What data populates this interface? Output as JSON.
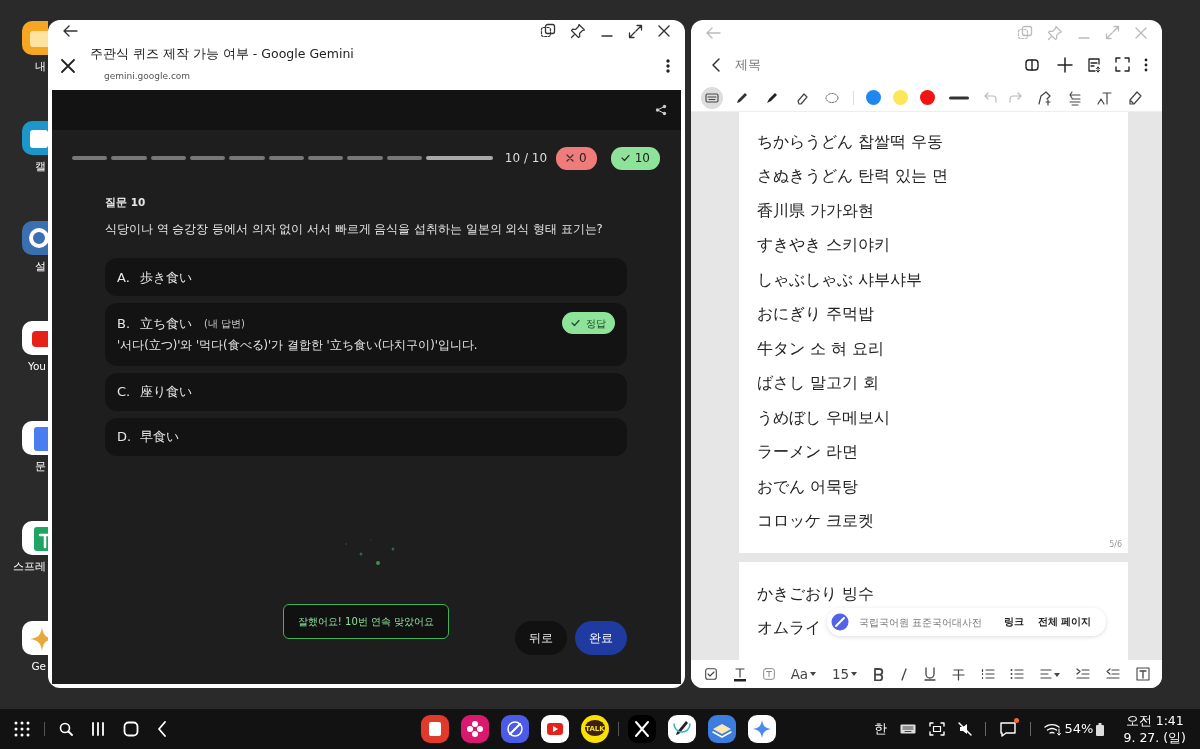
{
  "desktop_icons": [
    {
      "kind": "folder",
      "label": "내"
    },
    {
      "kind": "calendar",
      "label": "캘"
    },
    {
      "kind": "settings",
      "label": "설"
    },
    {
      "kind": "youtube",
      "label": "You"
    },
    {
      "kind": "docs",
      "label": "문"
    },
    {
      "kind": "sheets",
      "label": "스프레"
    },
    {
      "kind": "gemini",
      "label": "Ge"
    }
  ],
  "quiz_window": {
    "title": "주관식 퀴즈 제작 가능 여부 - Google Gemini",
    "url": "gemini.google.com",
    "progress": [
      {
        "current": false
      },
      {
        "current": false
      },
      {
        "current": false
      },
      {
        "current": false
      },
      {
        "current": false
      },
      {
        "current": false
      },
      {
        "current": false
      },
      {
        "current": false
      },
      {
        "current": false
      },
      {
        "current": true
      }
    ],
    "counter": "10 / 10",
    "wrong_count": "0",
    "right_count": "10",
    "question_label": "질문 10",
    "question": "식당이나 역 승강장 등에서 의자 없이 서서 빠르게 음식을 섭취하는 일본의 외식 형태 표기는?",
    "options": [
      {
        "letter": "A.",
        "text": "歩き食い"
      },
      {
        "letter": "B.",
        "text": "立ち食い",
        "note": "(내 답변)",
        "badge": "정답",
        "explanation": "'서다(立つ)'와 '먹다(食べる)'가 결합한 '立ち食い(다치구이)'입니다."
      },
      {
        "letter": "C.",
        "text": "座り食い"
      },
      {
        "letter": "D.",
        "text": "早食い"
      }
    ],
    "toast": "잘했어요! 10번 연속 맞았어요",
    "back_button": "뒤로",
    "done_button": "완료"
  },
  "notes_window": {
    "title": "제목",
    "tools": [
      {
        "kind": "keyboard",
        "selected": true
      },
      {
        "kind": "pen",
        "selected": false
      },
      {
        "kind": "highlighter",
        "selected": false
      },
      {
        "kind": "eraser",
        "selected": false
      },
      {
        "kind": "lasso",
        "selected": false
      }
    ],
    "colors": [
      {
        "color": "#1e88f0"
      },
      {
        "color": "#fde65a"
      },
      {
        "color": "#f01414"
      }
    ],
    "pages": [
      {
        "lines": [
          "ちからうどん 찹쌀떡 우동",
          "さぬきうどん 탄력 있는 면",
          "香川県 가가와현",
          "すきやき 스키야키",
          "しゃぶしゃぶ 샤부샤부",
          "おにぎり 주먹밥",
          "牛タン 소 혀 요리",
          "ばさし 말고기 회",
          "うめぼし 우메보시",
          "ラーメン 라면",
          "おでん 어묵탕",
          "コロッケ 크로켓"
        ],
        "page_number": "5/6"
      },
      {
        "lines": [
          "かきごおり 빙수",
          "オムライ"
        ]
      }
    ],
    "popup": {
      "source": "국립국어원 표준국어대사전",
      "actions": [
        "링크",
        "전체 페이지"
      ]
    },
    "font_button": "Aa",
    "size_button": "15"
  },
  "taskbar": {
    "dock": [
      {
        "kind": "notes"
      },
      {
        "kind": "flower"
      },
      {
        "kind": "browser"
      },
      {
        "kind": "youtube"
      },
      {
        "kind": "talk",
        "label": "TALK"
      },
      {
        "kind": "x"
      },
      {
        "kind": "pen-note"
      },
      {
        "kind": "stack"
      },
      {
        "kind": "gemini"
      }
    ],
    "input_language": "한",
    "notification_dot": true,
    "battery": "54%",
    "time": "오전 1:41",
    "date": "9. 27. (일)"
  }
}
